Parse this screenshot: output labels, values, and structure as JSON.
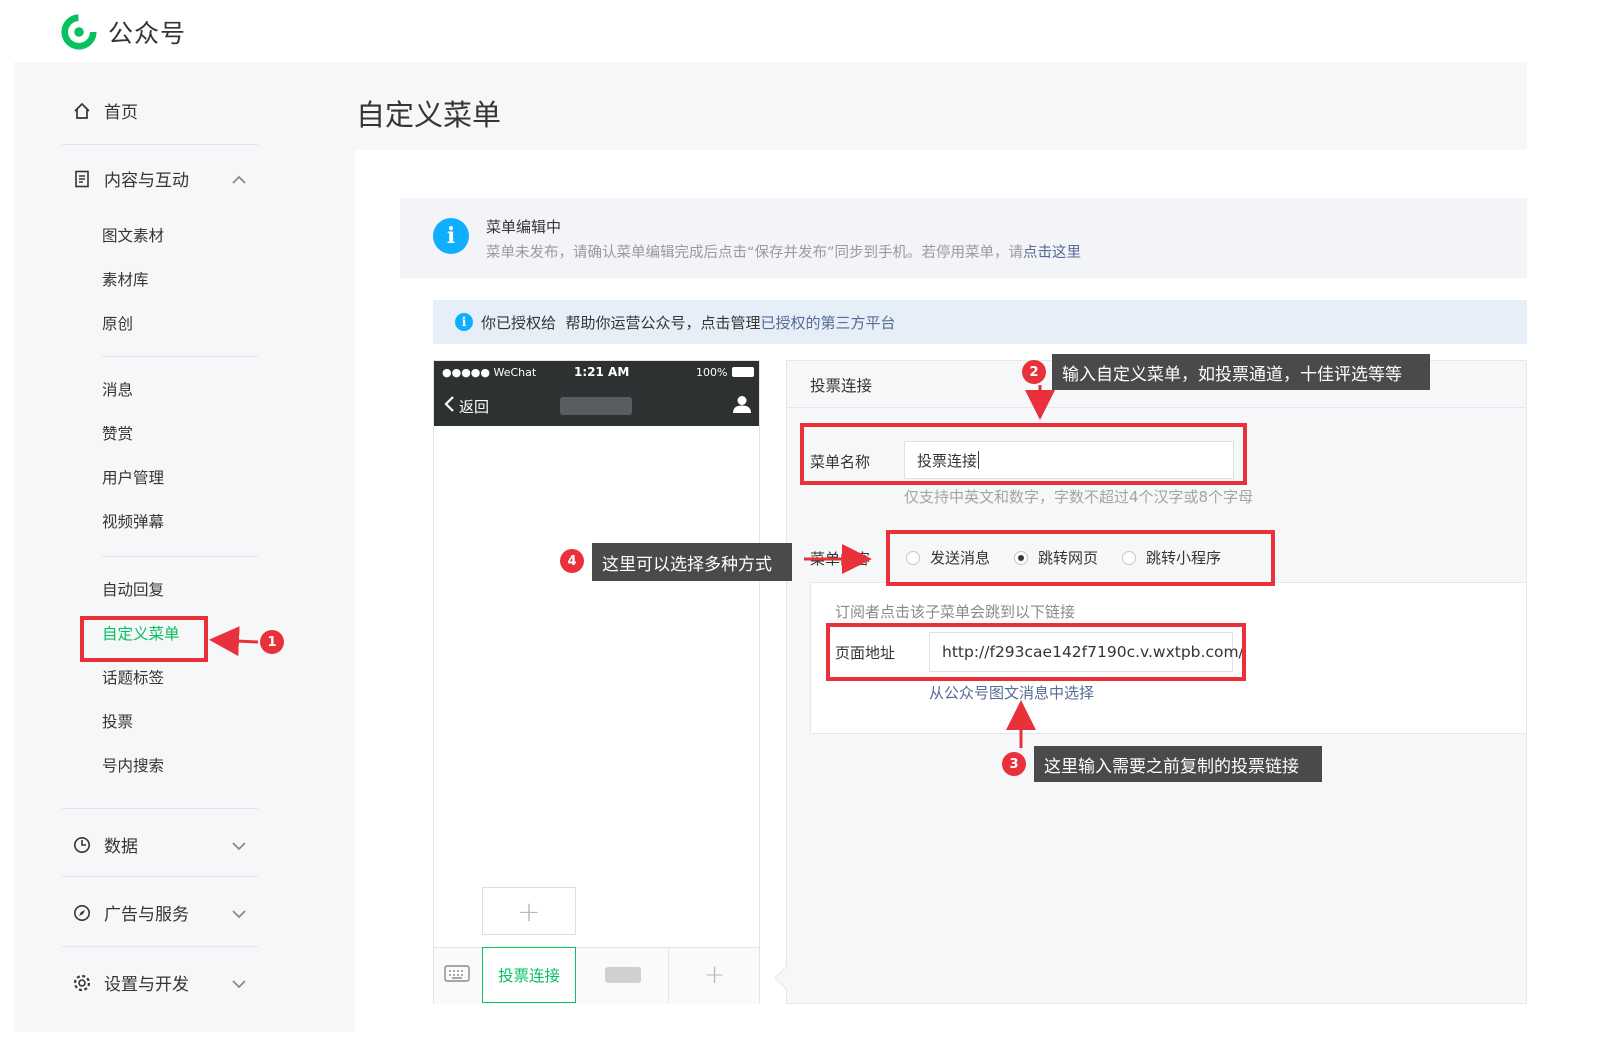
{
  "brand": {
    "name": "公众号",
    "color": "#07c160"
  },
  "sidebar": {
    "home": "首页",
    "content_group": "内容与互动",
    "content_items": [
      "图文素材",
      "素材库",
      "原创"
    ],
    "message_items": [
      "消息",
      "赞赏",
      "用户管理",
      "视频弹幕"
    ],
    "feature_items": [
      "自动回复",
      "自定义菜单",
      "话题标签",
      "投票",
      "号内搜索"
    ],
    "data_group": "数据",
    "ads_group": "广告与服务",
    "settings_group": "设置与开发"
  },
  "page": {
    "title": "自定义菜单"
  },
  "notice": {
    "title": "菜单编辑中",
    "desc_prefix": "菜单未发布，请确认菜单编辑完成后点击“保存并发布”同步到手机。若停用菜单，请",
    "desc_link": "点击这里"
  },
  "auth_bar": {
    "text": "你已授权给  帮助你运营公众号，点击管理",
    "link": "已授权的第三方平台"
  },
  "phone": {
    "carrier": "●●●●● WeChat",
    "time": "1:21 AM",
    "battery": "100%",
    "back": "返回",
    "menu_active": "投票连接",
    "add_symbol": "+"
  },
  "editor": {
    "title": "投票连接",
    "name_label": "菜单名称",
    "name_value": "投票连接",
    "name_hint": "仅支持中英文和数字，字数不超过4个汉字或8个字母",
    "content_label": "菜单内容",
    "options": [
      "发送消息",
      "跳转网页",
      "跳转小程序"
    ],
    "selected_option": "跳转网页",
    "jump_hint": "订阅者点击该子菜单会跳到以下链接",
    "url_label": "页面地址",
    "url_value": "http://f293cae142f7190c.v.wxtpb.com/",
    "pick_link": "从公众号图文消息中选择"
  },
  "annotations": [
    {
      "num": "1"
    },
    {
      "num": "2",
      "text": "输入自定义菜单，如投票通道，十佳评选等等"
    },
    {
      "num": "3",
      "text": "这里输入需要之前复制的投票链接"
    },
    {
      "num": "4",
      "text": "这里可以选择多种方式"
    }
  ],
  "colors": {
    "annotation_red": "#e8313b",
    "link_blue": "#576b95",
    "info_blue": "#10aeff",
    "active_green": "#07c160"
  }
}
